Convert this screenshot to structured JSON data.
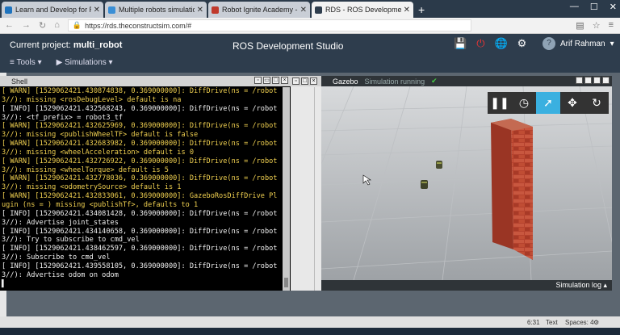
{
  "browser": {
    "tabs": [
      {
        "label": "Learn and Develop for Robots u",
        "color": "#1e73be",
        "active": false
      },
      {
        "label": "Multiple robots simulation and",
        "color": "#3a8fd6",
        "active": false
      },
      {
        "label": "Robot Ignite Academy - ROS L",
        "color": "#c0392b",
        "active": false
      },
      {
        "label": "RDS - ROS Development Studio",
        "color": "#2e3d4d",
        "active": true
      }
    ],
    "new_tab": "+",
    "url": "https://rds.theconstructsim.com/#"
  },
  "header": {
    "project_label": "Current project:",
    "project_name": "multi_robot",
    "title": "ROS Development Studio",
    "tools_label": "Tools",
    "simulations_label": "Simulations",
    "user_name": "Arif Rahman"
  },
  "shell": {
    "title": "Shell",
    "lines": [
      {
        "t": "[ WARN] [1529062421.430874838, 0.369000000]: DiffDrive(ns = /robot",
        "k": "w"
      },
      {
        "t": "3//): missing <rosDebugLevel> default is na",
        "k": "w"
      },
      {
        "t": "[ INFO] [1529062421.432568243, 0.369000000]: DiffDrive(ns = /robot",
        "k": "i"
      },
      {
        "t": "3//): <tf_prefix> = robot3_tf",
        "k": "i"
      },
      {
        "t": "[ WARN] [1529062421.432625969, 0.369000000]: DiffDrive(ns = /robot",
        "k": "w"
      },
      {
        "t": "3//): missing <publishWheelTF> default is false",
        "k": "w"
      },
      {
        "t": "[ WARN] [1529062421.432683982, 0.369000000]: DiffDrive(ns = /robot",
        "k": "w"
      },
      {
        "t": "3//): missing <wheelAcceleration> default is 0",
        "k": "w"
      },
      {
        "t": "[ WARN] [1529062421.432726922, 0.369000000]: DiffDrive(ns = /robot",
        "k": "w"
      },
      {
        "t": "3//): missing <wheelTorque> default is 5",
        "k": "w"
      },
      {
        "t": "[ WARN] [1529062421.432778036, 0.369000000]: DiffDrive(ns = /robot",
        "k": "w"
      },
      {
        "t": "3//): missing <odometrySource> default is 1",
        "k": "w"
      },
      {
        "t": "[ WARN] [1529062421.432833061, 0.369000000]: GazeboRosDiffDrive Pl",
        "k": "w"
      },
      {
        "t": "ugin (ns = ) missing <publishTf>, defaults to 1",
        "k": "w"
      },
      {
        "t": "[ INFO] [1529062421.434081428, 0.369000000]: DiffDrive(ns = /robot",
        "k": "i"
      },
      {
        "t": "3//): Advertise joint_states",
        "k": "i"
      },
      {
        "t": "[ INFO] [1529062421.434140658, 0.369000000]: DiffDrive(ns = /robot",
        "k": "i"
      },
      {
        "t": "3//): Try to subscribe to cmd_vel",
        "k": "i"
      },
      {
        "t": "[ INFO] [1529062421.438462597, 0.369000000]: DiffDrive(ns = /robot",
        "k": "i"
      },
      {
        "t": "3//): Subscribe to cmd_vel",
        "k": "i"
      },
      {
        "t": "[ INFO] [1529062421.439558105, 0.369000000]: DiffDrive(ns = /robot",
        "k": "i"
      },
      {
        "t": "3//): Advertise odom on odom",
        "k": "i"
      },
      {
        "t": "▌",
        "k": "i"
      }
    ]
  },
  "gazebo": {
    "title": "Gazebo",
    "status": "Simulation running",
    "sim_log": "Simulation log"
  },
  "status_bar": {
    "position": "6:31",
    "mode": "Text",
    "spaces": "Spaces: 4"
  }
}
